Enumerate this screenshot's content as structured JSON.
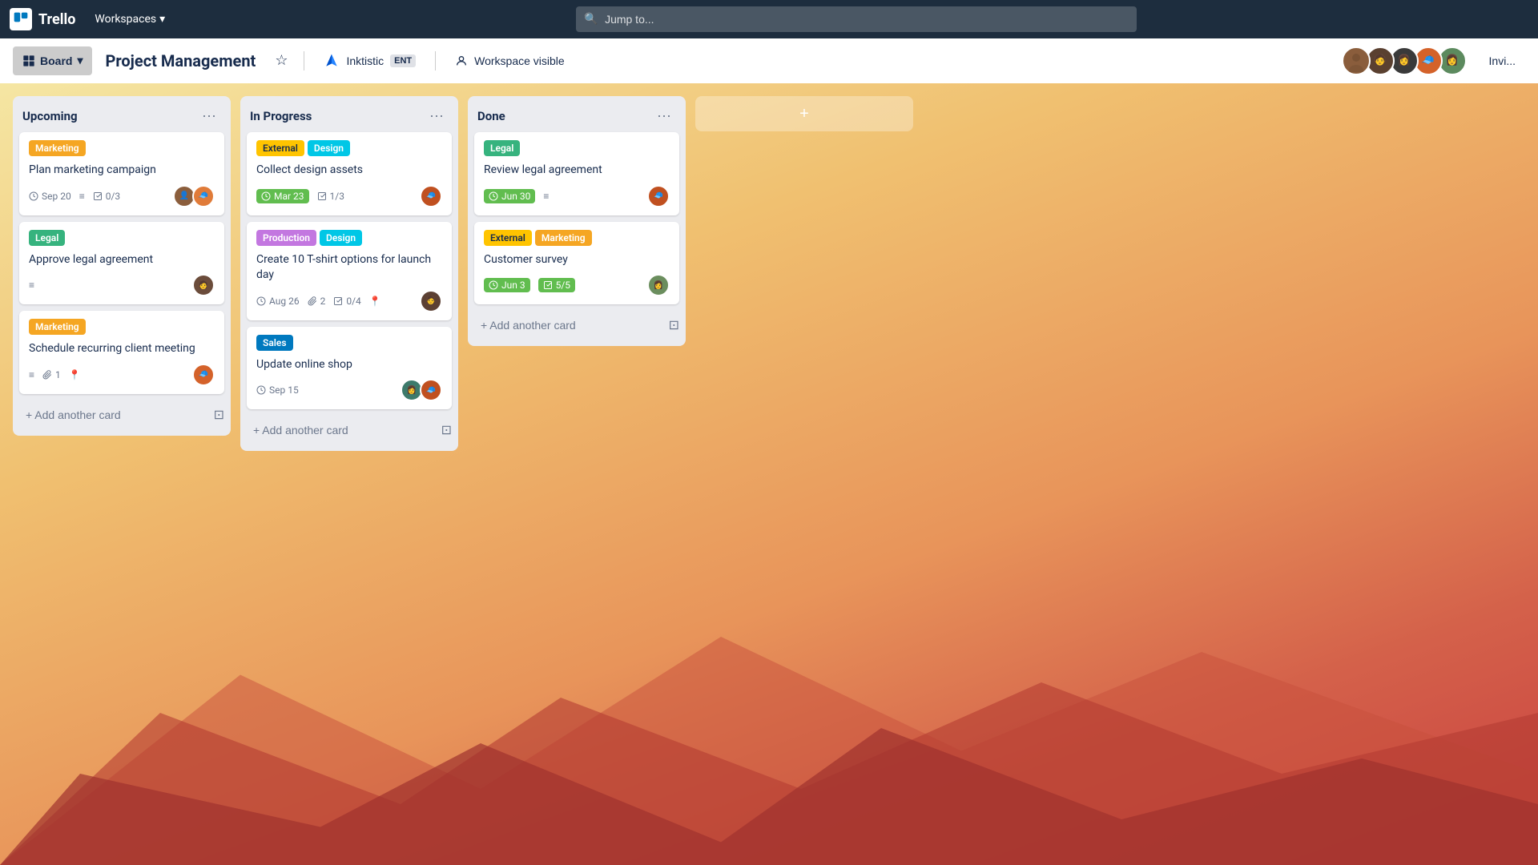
{
  "nav": {
    "logo_text": "Trello",
    "workspaces_label": "Workspaces",
    "search_placeholder": "Jump to...",
    "chevron_down": "▾"
  },
  "toolbar": {
    "board_view_label": "Board",
    "board_title": "Project Management",
    "star_icon": "☆",
    "workspace_name": "Inktistic",
    "workspace_badge": "ENT",
    "workspace_visible_label": "Workspace visible",
    "invite_label": "Invi..."
  },
  "columns": [
    {
      "id": "upcoming",
      "title": "Upcoming",
      "cards": [
        {
          "id": "c1",
          "labels": [
            {
              "text": "Marketing",
              "cls": "label-marketing"
            }
          ],
          "title": "Plan marketing campaign",
          "due": "Sep 20",
          "due_color": "normal",
          "has_description": true,
          "checklist": "0/3",
          "avatars": [
            "A1",
            "A2"
          ]
        },
        {
          "id": "c2",
          "labels": [
            {
              "text": "Legal",
              "cls": "label-legal"
            }
          ],
          "title": "Approve legal agreement",
          "has_description": true,
          "avatars": [
            "A3"
          ]
        },
        {
          "id": "c3",
          "labels": [
            {
              "text": "Marketing",
              "cls": "label-marketing"
            }
          ],
          "title": "Schedule recurring client meeting",
          "has_description": true,
          "attachments": "1",
          "has_location": true,
          "avatars": [
            "A4"
          ]
        }
      ],
      "add_card_label": "+ Add another card"
    },
    {
      "id": "in-progress",
      "title": "In Progress",
      "cards": [
        {
          "id": "c4",
          "labels": [
            {
              "text": "External",
              "cls": "label-external"
            },
            {
              "text": "Design",
              "cls": "label-design"
            }
          ],
          "title": "Collect design assets",
          "due": "Mar 23",
          "due_color": "green",
          "checklist": "1/3",
          "avatars": [
            "A5"
          ]
        },
        {
          "id": "c5",
          "labels": [
            {
              "text": "Production",
              "cls": "label-production"
            },
            {
              "text": "Design",
              "cls": "label-design"
            }
          ],
          "title": "Create 10 T-shirt options for launch day",
          "due": "Aug 26",
          "due_color": "normal",
          "attachments": "2",
          "checklist": "0/4",
          "has_location": true,
          "avatars": [
            "A6"
          ]
        },
        {
          "id": "c6",
          "labels": [
            {
              "text": "Sales",
              "cls": "label-sales"
            }
          ],
          "title": "Update online shop",
          "due": "Sep 15",
          "due_color": "normal",
          "avatars": [
            "A7",
            "A8"
          ]
        }
      ],
      "add_card_label": "+ Add another card"
    },
    {
      "id": "done",
      "title": "Done",
      "cards": [
        {
          "id": "c7",
          "labels": [
            {
              "text": "Legal",
              "cls": "label-legal"
            }
          ],
          "title": "Review legal agreement",
          "due": "Jun 30",
          "due_color": "green",
          "has_description": true,
          "avatars": [
            "A9"
          ]
        },
        {
          "id": "c8",
          "labels": [
            {
              "text": "External",
              "cls": "label-external"
            },
            {
              "text": "Marketing",
              "cls": "label-marketing"
            }
          ],
          "title": "Customer survey",
          "due": "Jun 3",
          "due_color": "green",
          "checklist": "5/5",
          "checklist_done": true,
          "avatars": [
            "A10"
          ]
        }
      ],
      "add_card_label": "+ Add another card"
    }
  ],
  "add_column_label": "+",
  "colors": {
    "av1": "#8B5E3C",
    "av2": "#E07B39",
    "av3": "#6B4C3B",
    "av4": "#D4622A",
    "av5": "#C05020",
    "av6": "#5C4033",
    "av7": "#3D7A6B",
    "av8": "#C05020",
    "av9": "#C05020",
    "av10": "#6B8E5E"
  }
}
